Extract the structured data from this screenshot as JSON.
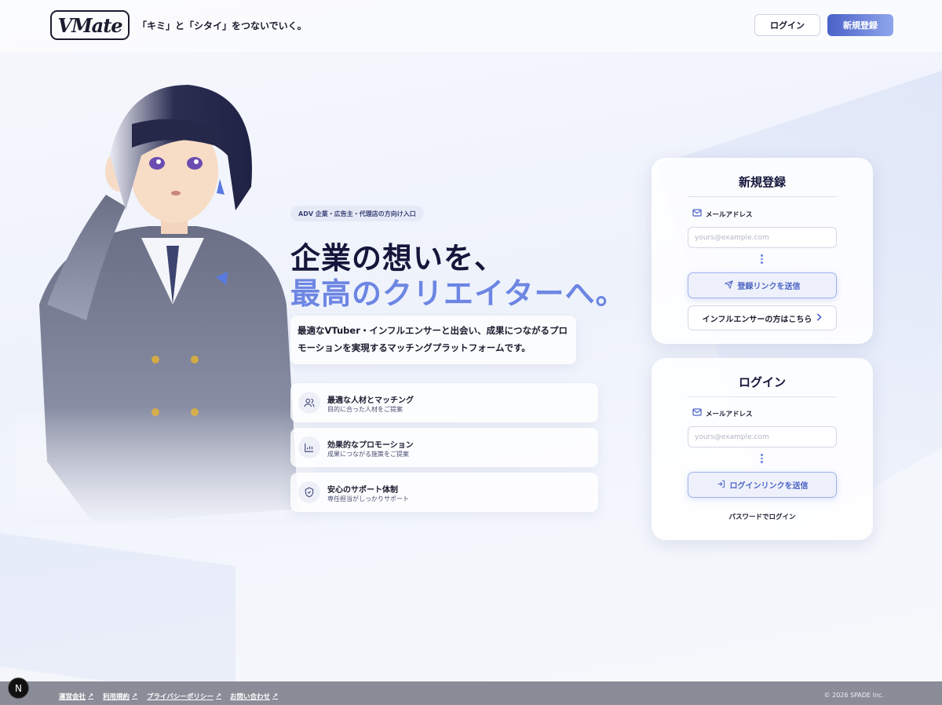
{
  "header": {
    "logo": "VMate",
    "tagline": "「キミ」と「シタイ」をつないでいく。",
    "login_label": "ログイン",
    "signup_label": "新規登録"
  },
  "hero": {
    "badge": "ADV 企業・広告主・代理店の方向け入口",
    "headline_line1": "企業の想いを、",
    "headline_line2": "最高のクリエイターへ。",
    "description": "最適なVTuber・インフルエンサーと出会い、成果につながるプロモーションを実現するマッチングプラットフォームです。",
    "accent_color": "#6d86e3"
  },
  "features": [
    {
      "icon": "users-icon",
      "title": "最適な人材とマッチング",
      "subtitle": "目的に合った人材をご提案"
    },
    {
      "icon": "bar-chart-icon",
      "title": "効果的なプロモーション",
      "subtitle": "成果につながる施策をご提案"
    },
    {
      "icon": "shield-check-icon",
      "title": "安心のサポート体制",
      "subtitle": "専任担当がしっかりサポート"
    }
  ],
  "signup_card": {
    "title": "新規登録",
    "email_label": "メールアドレス",
    "email_placeholder": "yours@example.com",
    "email_value": "",
    "send_label": "登録リンクを送信",
    "influencer_label": "インフルエンサーの方はこちら"
  },
  "login_card": {
    "title": "ログイン",
    "email_label": "メールアドレス",
    "email_placeholder": "yours@example.com",
    "email_value": "",
    "send_label": "ログインリンクを送信",
    "password_link": "パスワードでログイン"
  },
  "footer": {
    "links": [
      "運営会社",
      "利用規約",
      "プライバシーポリシー",
      "お問い合わせ"
    ],
    "copyright": "© 2026 SPADE Inc.",
    "dev_badge": "N"
  }
}
